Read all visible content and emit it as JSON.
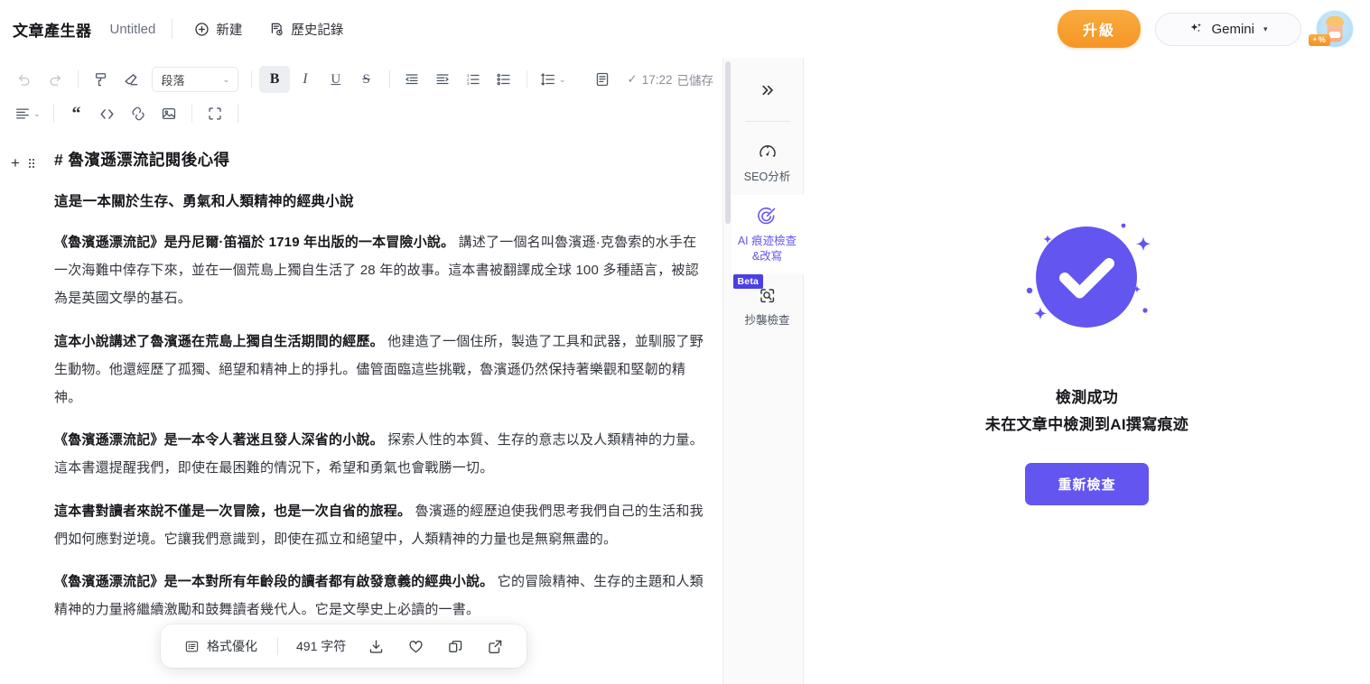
{
  "header": {
    "brand": "文章產生器",
    "doc_title": "Untitled",
    "actions": [
      {
        "label": "新建",
        "icon": "plus-circle-icon"
      },
      {
        "label": "歷史記錄",
        "icon": "history-icon"
      }
    ],
    "upgrade_label": "升級",
    "model_label": "Gemini",
    "model_caret": "▾",
    "avatar_badge": "%"
  },
  "toolbar": {
    "row1": [
      {
        "name": "undo-icon",
        "title": "復原"
      },
      {
        "name": "redo-icon",
        "title": "重做"
      },
      {
        "name": "format-painter-icon",
        "title": "格式刷"
      },
      {
        "name": "clear-format-icon",
        "title": "清除格式"
      }
    ],
    "style_select": {
      "value": "段落",
      "caret": "⌄"
    },
    "row1b": [
      {
        "name": "bold-icon",
        "label": "B",
        "active": true
      },
      {
        "name": "italic-icon",
        "label": "I",
        "active": false
      },
      {
        "name": "underline-icon",
        "label": "U",
        "active": false
      },
      {
        "name": "strikethrough-icon",
        "label": "S",
        "active": false
      },
      {
        "name": "outdent-icon"
      },
      {
        "name": "indent-icon"
      },
      {
        "name": "ordered-list-icon"
      },
      {
        "name": "bullet-list-icon"
      },
      {
        "name": "line-height-icon"
      },
      {
        "name": "page-icon"
      }
    ],
    "save_status": {
      "check": "✓",
      "time": "17:22",
      "text": "已儲存"
    },
    "row2": [
      {
        "name": "align-left-icon"
      },
      {
        "name": "quote-icon"
      },
      {
        "name": "code-icon"
      },
      {
        "name": "link-icon"
      },
      {
        "name": "image-icon"
      },
      {
        "name": "fullscreen-icon"
      }
    ]
  },
  "document": {
    "heading": "# 魯濱遜漂流記閱後心得",
    "subheading": "這是一本關於生存、勇氣和人類精神的經典小說",
    "paragraphs": [
      {
        "lead": "《魯濱遜漂流記》是丹尼爾·笛福於 1719 年出版的一本冒險小說。",
        "rest": " 講述了一個名叫魯濱遜·克魯索的水手在一次海難中倖存下來，並在一個荒島上獨自生活了 28 年的故事。這本書被翻譯成全球 100 多種語言，被認為是英國文學的基石。"
      },
      {
        "lead": "這本小說講述了魯濱遜在荒島上獨自生活期間的經歷。",
        "rest": " 他建造了一個住所，製造了工具和武器，並馴服了野生動物。他還經歷了孤獨、絕望和精神上的掙扎。儘管面臨這些挑戰，魯濱遜仍然保持著樂觀和堅韌的精神。"
      },
      {
        "lead": "《魯濱遜漂流記》是一本令人著迷且發人深省的小說。",
        "rest": " 探索人性的本質、生存的意志以及人類精神的力量。這本書還提醒我們，即使在最困難的情況下，希望和勇氣也會戰勝一切。"
      },
      {
        "lead": "這本書對讀者來說不僅是一次冒險，也是一次自省的旅程。",
        "rest": " 魯濱遜的經歷迫使我們思考我們自己的生活和我們如何應對逆境。它讓我們意識到，即使在孤立和絕望中，人類精神的力量也是無窮無盡的。"
      },
      {
        "lead": "《魯濱遜漂流記》是一本對所有年齡段的讀者都有啟發意義的經典小說。",
        "rest": " 它的冒險精神、生存的主題和人類精神的力量將繼續激勵和鼓舞讀者幾代人。它是文學史上必讀的一書。"
      }
    ]
  },
  "float_bar": {
    "format_label": "格式優化",
    "char_count": "491 字符",
    "icons": [
      {
        "name": "download-icon"
      },
      {
        "name": "heart-icon"
      },
      {
        "name": "copy-icon"
      },
      {
        "name": "share-external-icon"
      }
    ]
  },
  "rail": {
    "collapse_icon": "chevron-double-right-icon",
    "items": [
      {
        "label": "SEO分析",
        "icon": "speedometer-icon",
        "selected": false,
        "badge": ""
      },
      {
        "label": "AI 痕迹檢查&改寫",
        "icon": "ai-rewrite-icon",
        "selected": true,
        "badge": ""
      },
      {
        "label": "抄襲檢查",
        "icon": "plagiarism-search-icon",
        "selected": false,
        "badge": "Beta"
      }
    ]
  },
  "panel": {
    "status_icon": "success-check-icon",
    "title_line1": "檢測成功",
    "title_line2": "未在文章中檢測到AI撰寫痕迹",
    "recheck_label": "重新檢查",
    "accent_color": "#6355F0"
  }
}
